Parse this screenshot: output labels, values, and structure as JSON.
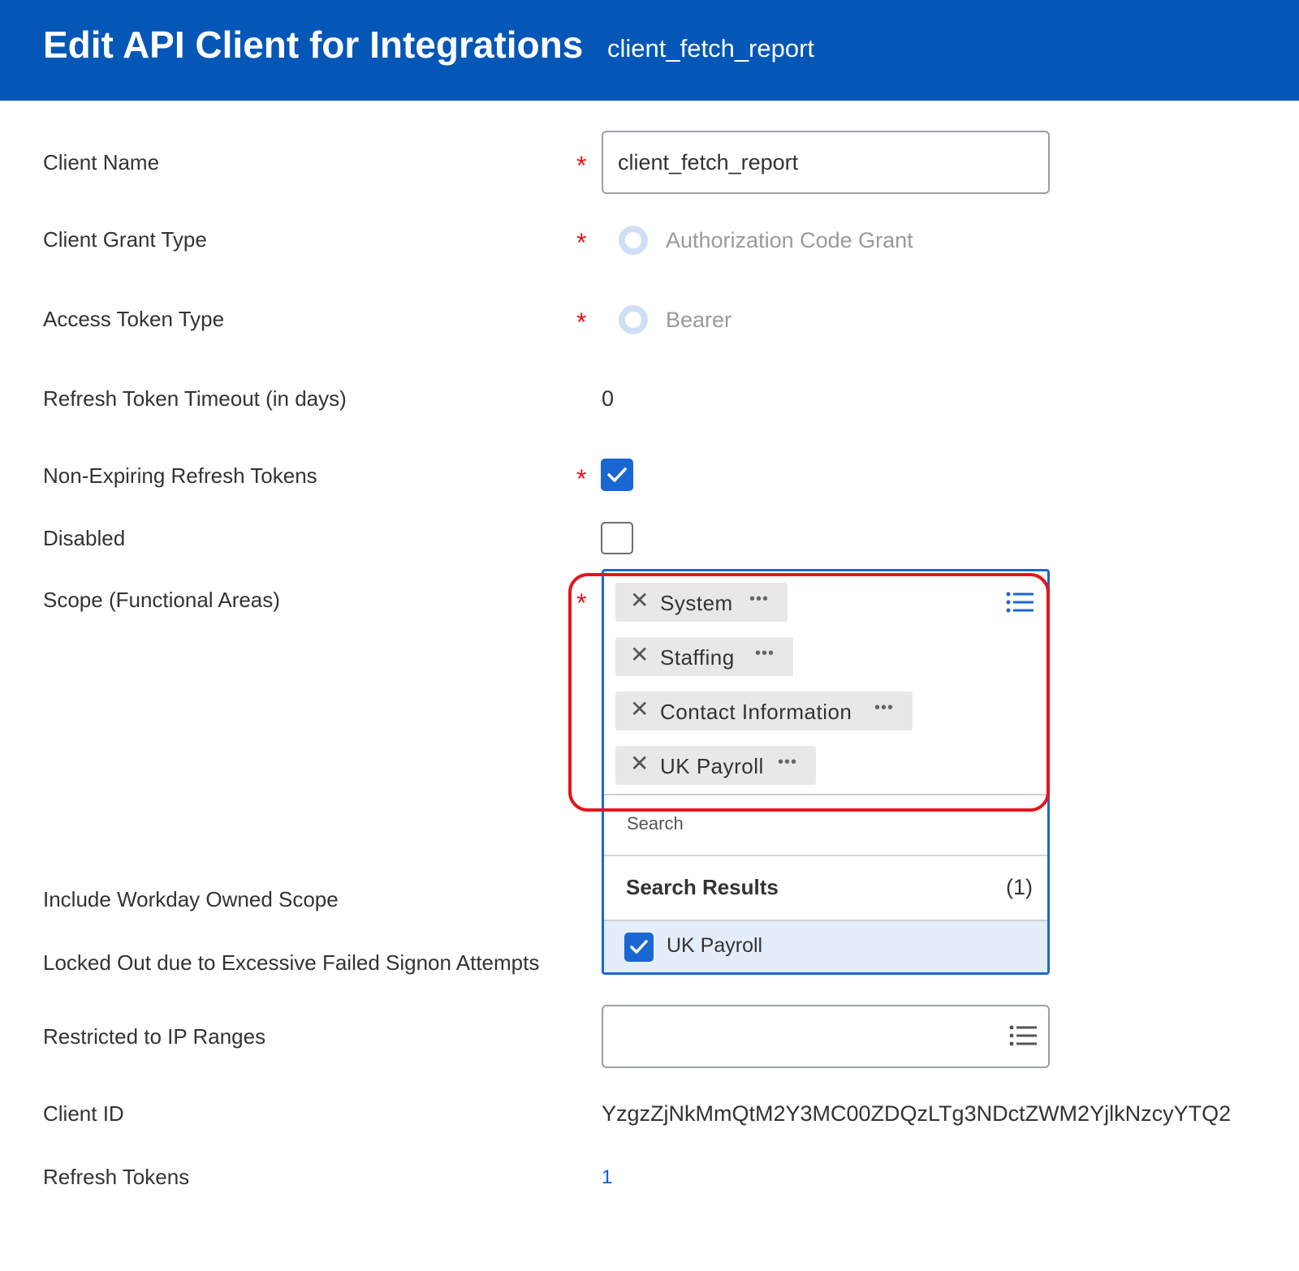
{
  "header": {
    "title": "Edit API Client for Integrations",
    "subtitle": "client_fetch_report"
  },
  "form": {
    "client_name": {
      "label": "Client Name",
      "value": "client_fetch_report",
      "required": true
    },
    "client_grant_type": {
      "label": "Client Grant Type",
      "option": "Authorization Code Grant",
      "required": true
    },
    "access_token_type": {
      "label": "Access Token Type",
      "option": "Bearer",
      "required": true
    },
    "refresh_token_timeout": {
      "label": "Refresh Token Timeout (in days)",
      "value": "0"
    },
    "non_expiring_refresh_tokens": {
      "label": "Non-Expiring Refresh Tokens",
      "checked": true,
      "required": true
    },
    "disabled": {
      "label": "Disabled",
      "checked": false
    },
    "scope": {
      "label": "Scope (Functional Areas)",
      "required": true,
      "selected": [
        "System",
        "Staffing",
        "Contact Information",
        "UK Payroll"
      ],
      "search_placeholder": "Search",
      "results_title": "Search Results",
      "results_count": "(1)",
      "results": [
        {
          "label": "UK Payroll",
          "checked": true
        }
      ]
    },
    "include_workday_owned_scope": {
      "label": "Include Workday Owned Scope"
    },
    "locked_out": {
      "label": "Locked Out due to Excessive Failed Signon Attempts"
    },
    "restricted_ip": {
      "label": "Restricted to IP Ranges"
    },
    "client_id": {
      "label": "Client ID",
      "value": "YzgzZjNkMmQtM2Y3MC00ZDQzLTg3NDctZWM2YjlkNzcyYTQ2"
    },
    "refresh_tokens": {
      "label": "Refresh Tokens",
      "value": "1"
    }
  },
  "colors": {
    "header_bg": "#0457b7",
    "accent": "#1a67d2",
    "required": "#e4151b",
    "highlight_outline": "#e4151b"
  },
  "icons": {
    "remove": "close-icon",
    "related_actions": "ellipsis-icon",
    "prompt": "list-icon",
    "check": "checkmark-icon"
  }
}
